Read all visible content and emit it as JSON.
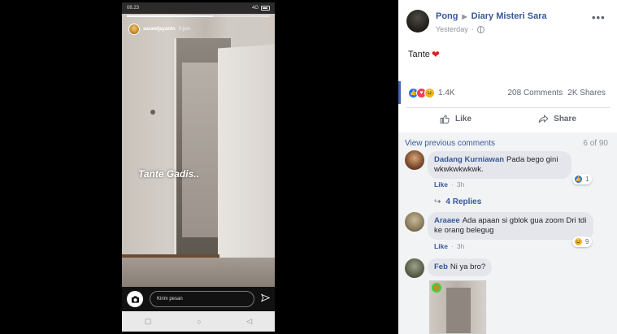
{
  "phone": {
    "status_time": "08.23",
    "status_icons": "⚠ ⊡ ⋯",
    "network": "4G",
    "profile_name": "sarawijayanto",
    "profile_time": "9 jam",
    "story_text": "Tante Gadis..",
    "message_placeholder": "Kirim pesan",
    "nav_recent": "▢",
    "nav_home": "○",
    "nav_back": "◁"
  },
  "post": {
    "author": "Pong",
    "page": "Diary Misteri Sara",
    "time": "Yesterday",
    "text": "Tante",
    "more": "•••",
    "reaction_count": "1.4K",
    "comments_count": "208 Comments",
    "shares_count": "2K Shares",
    "like_label": "Like",
    "share_label": "Share"
  },
  "comments": {
    "view_previous": "View previous comments",
    "position": "6 of 90",
    "items": [
      {
        "name": "Dadang Kurniawan",
        "text_line1": "Pada bego gini",
        "text_line2": "wkwkwkwkwk.",
        "like_label": "Like",
        "time": "3h",
        "reaction_count": "1",
        "replies": "4 Replies"
      },
      {
        "name": "Araaee",
        "text_line1": "Ada apaan si gblok gua zoom Dri tdi",
        "text_line2": "ke orang belegug",
        "like_label": "Like",
        "time": "3h",
        "reaction_count": "9"
      },
      {
        "name": "Feb",
        "text_line1": "Ni ya bro?"
      }
    ]
  },
  "colors": {
    "link": "#385898",
    "like_blue": "#1877f2",
    "love_red": "#f33e58",
    "haha_yellow": "#f7b125"
  }
}
